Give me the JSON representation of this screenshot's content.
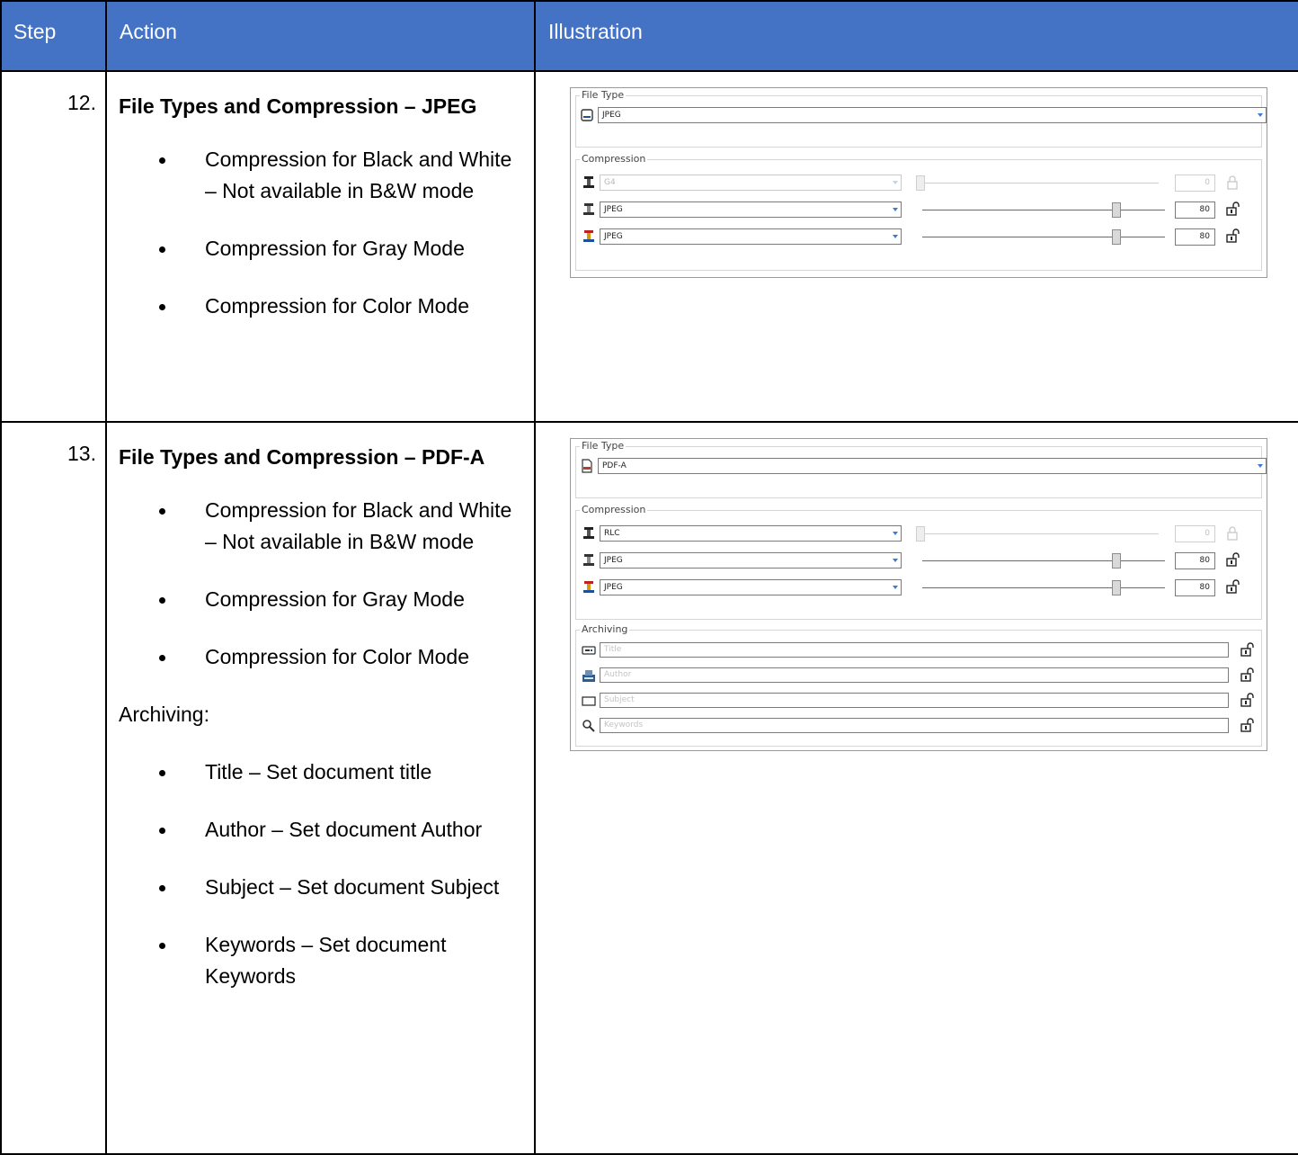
{
  "header": {
    "step": "Step",
    "action": "Action",
    "illustration": "Illustration"
  },
  "rows": [
    {
      "step": "12.",
      "title": "File Types and Compression – JPEG",
      "bullets": [
        "Compression for Black and White – Not available in B&W mode",
        "Compression for Gray Mode",
        "Compression for Color Mode"
      ],
      "illustration": {
        "file_type_label": "File Type",
        "file_type_value": "JPEG",
        "compression_label": "Compression",
        "compression": [
          {
            "mode": "Black and White",
            "codec": "G4",
            "value": "0",
            "quality": 0,
            "disabled": true
          },
          {
            "mode": "Gray",
            "codec": "JPEG",
            "value": "80",
            "quality": 80,
            "disabled": false
          },
          {
            "mode": "Color",
            "codec": "JPEG",
            "value": "80",
            "quality": 80,
            "disabled": false
          }
        ]
      }
    },
    {
      "step": "13.",
      "title": "File Types and Compression – PDF-A",
      "bullets": [
        "Compression for Black and White – Not available in B&W mode",
        "Compression for Gray Mode",
        "Compression for Color Mode"
      ],
      "archiving_label": "Archiving:",
      "archiving_bullets": [
        "Title – Set document title",
        "Author – Set document Author",
        "Subject – Set document Subject",
        "Keywords – Set document Keywords"
      ],
      "illustration": {
        "file_type_label": "File Type",
        "file_type_value": "PDF-A",
        "compression_label": "Compression",
        "compression": [
          {
            "mode": "Black and White",
            "codec": "RLC",
            "value": "0",
            "quality": 0,
            "disabled": true
          },
          {
            "mode": "Gray",
            "codec": "JPEG",
            "value": "80",
            "quality": 80,
            "disabled": false
          },
          {
            "mode": "Color",
            "codec": "JPEG",
            "value": "80",
            "quality": 80,
            "disabled": false
          }
        ],
        "archiving_label": "Archiving",
        "archiving_fields": [
          {
            "placeholder": "Title",
            "icon": "title-icon"
          },
          {
            "placeholder": "Author",
            "icon": "author-icon"
          },
          {
            "placeholder": "Subject",
            "icon": "subject-icon"
          },
          {
            "placeholder": "Keywords",
            "icon": "keywords-icon"
          }
        ]
      }
    }
  ]
}
